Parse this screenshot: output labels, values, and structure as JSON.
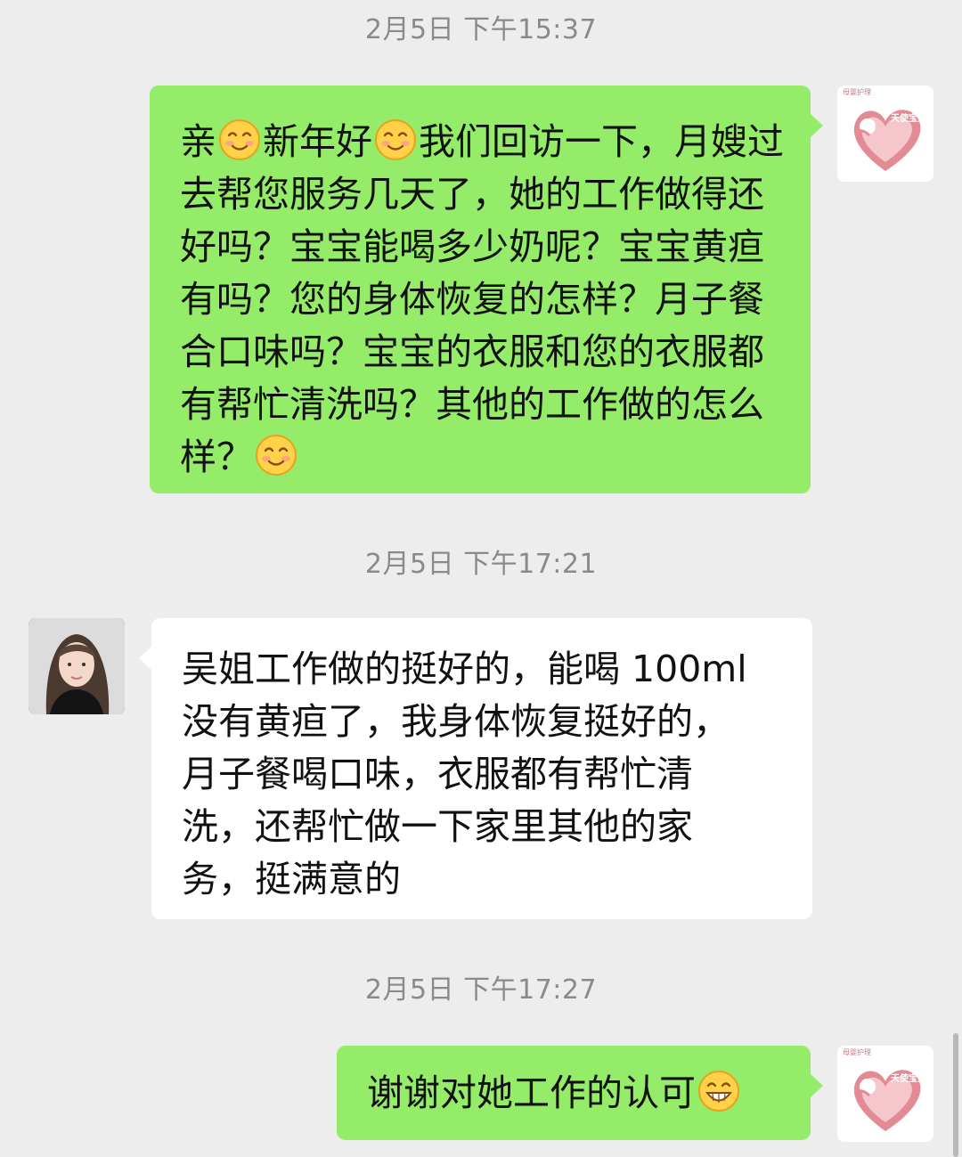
{
  "chat": {
    "timestamps": [
      "2月5日 下午15:37",
      "2月5日 下午17:21",
      "2月5日 下午17:27"
    ],
    "messages": [
      {
        "side": "out",
        "segments": [
          "亲",
          "新年好",
          "我们回访一下，月嫂过去帮您服务几天了，她的工作做得还好吗？宝宝能喝多少奶呢？宝宝黄疸有吗？您的身体恢复的怎样？月子餐合口味吗？宝宝的衣服和您的衣服都有帮忙清洗吗？其他的工作做的怎么样？"
        ],
        "emojis": [
          "smile-emoji",
          "smile-emoji",
          "smile-emoji"
        ]
      },
      {
        "side": "in",
        "text": "吴姐工作做的挺好的，能喝 100ml\n没有黄疸了，我身体恢复挺好的，\n月子餐喝口味，衣服都有帮忙清\n洗，还帮忙做一下家里其他的家\n务，挺满意的"
      },
      {
        "side": "out",
        "text": "谢谢对她工作的认可",
        "emojis": [
          "grin-emoji"
        ]
      }
    ]
  },
  "avatars": {
    "brand_logo_text": "天使宝贝",
    "brand_small_text": "母婴护理"
  },
  "colors": {
    "background": "#ededed",
    "outgoing_bubble": "#95ec69",
    "incoming_bubble": "#ffffff",
    "timestamp_text": "#8a8a8a",
    "logo_heart": "#e38b95"
  }
}
